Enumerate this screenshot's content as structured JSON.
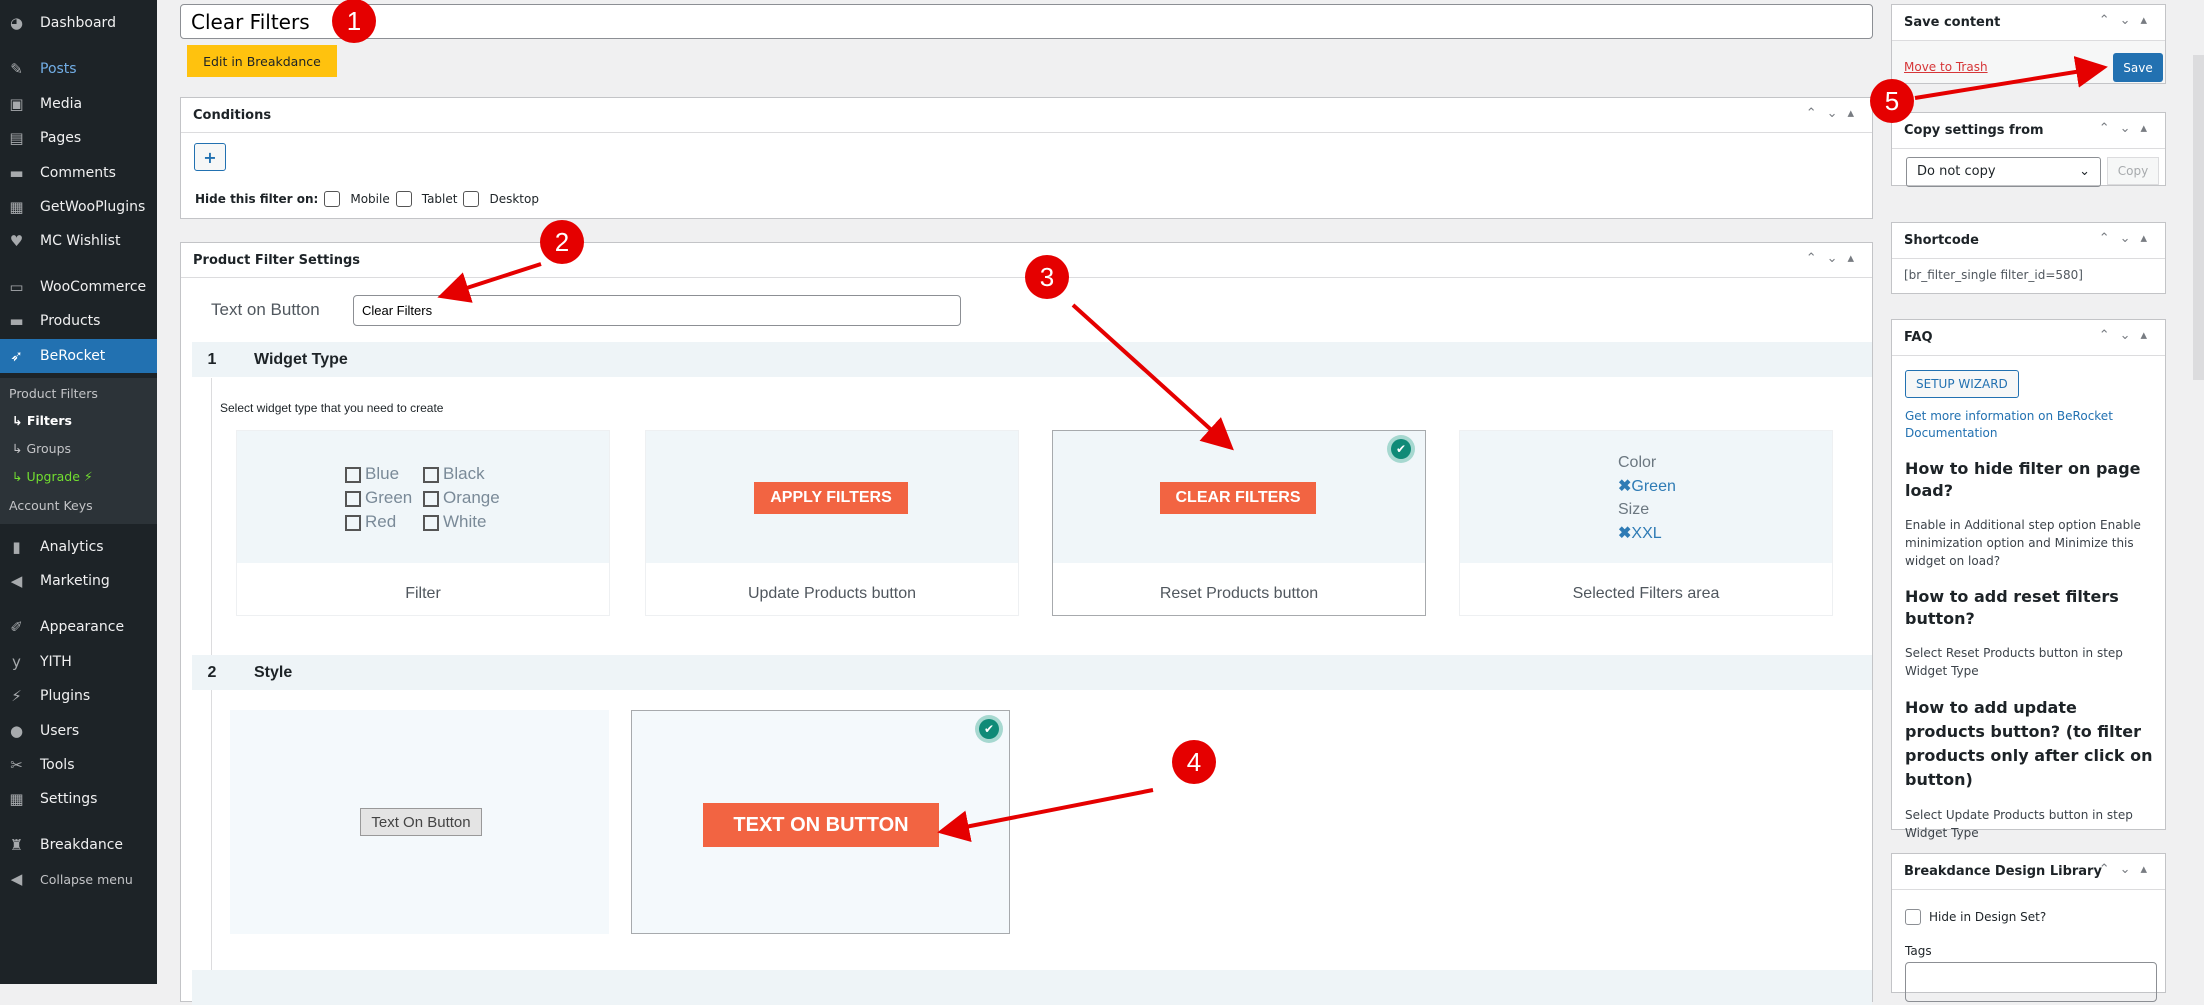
{
  "sidebar": {
    "items": [
      {
        "label": "Dashboard",
        "icon": "dashboard-icon",
        "glyph": "◕"
      },
      {
        "label": "Posts",
        "icon": "pin-icon",
        "glyph": "✎"
      },
      {
        "label": "Media",
        "icon": "media-icon",
        "glyph": "▣"
      },
      {
        "label": "Pages",
        "icon": "pages-icon",
        "glyph": "▤"
      },
      {
        "label": "Comments",
        "icon": "comment-icon",
        "glyph": "▬"
      },
      {
        "label": "GetWooPlugins",
        "icon": "plugin-box-icon",
        "glyph": "▦"
      },
      {
        "label": "MC Wishlist",
        "icon": "heart-icon",
        "glyph": "♥"
      },
      {
        "label": "WooCommerce",
        "icon": "woo-icon",
        "glyph": "▭"
      },
      {
        "label": "Products",
        "icon": "products-icon",
        "glyph": "▬"
      },
      {
        "label": "BeRocket",
        "icon": "rocket-icon",
        "glyph": "➶"
      },
      {
        "label": "Analytics",
        "icon": "analytics-icon",
        "glyph": "▮"
      },
      {
        "label": "Marketing",
        "icon": "megaphone-icon",
        "glyph": "◀"
      },
      {
        "label": "Appearance",
        "icon": "brush-icon",
        "glyph": "✐"
      },
      {
        "label": "YITH",
        "icon": "yith-icon",
        "glyph": "y"
      },
      {
        "label": "Plugins",
        "icon": "plug-icon",
        "glyph": "⚡"
      },
      {
        "label": "Users",
        "icon": "user-icon",
        "glyph": "●"
      },
      {
        "label": "Tools",
        "icon": "wrench-icon",
        "glyph": "✂"
      },
      {
        "label": "Settings",
        "icon": "settings-icon",
        "glyph": "▦"
      },
      {
        "label": "Breakdance",
        "icon": "breakdance-icon",
        "glyph": "♜"
      },
      {
        "label": "Collapse menu",
        "icon": "collapse-icon",
        "glyph": "◀"
      }
    ],
    "submenu": {
      "title": "Product Filters",
      "filters": "↳ Filters",
      "groups": "↳ Groups",
      "upgrade": "↳ Upgrade ⚡",
      "account": "Account Keys"
    }
  },
  "title_value": "Clear Filters",
  "edit_breakdance": "Edit in Breakdance",
  "conditions": {
    "title": "Conditions",
    "add": "+",
    "hide_label": "Hide this filter on:",
    "options": [
      "Mobile",
      "Tablet",
      "Desktop"
    ]
  },
  "settings": {
    "title": "Product Filter Settings",
    "text_label": "Text on Button",
    "text_value": "Clear Filters",
    "step1": {
      "num": "1",
      "title": "Widget Type",
      "hint": "Select widget type that you need to create",
      "cards": [
        {
          "label": "Filter"
        },
        {
          "label": "Update Products button",
          "button": "APPLY FILTERS"
        },
        {
          "label": "Reset Products button",
          "button": "CLEAR FILTERS",
          "selected": true
        },
        {
          "label": "Selected Filters area"
        }
      ],
      "filter_options": [
        "Blue",
        "Black",
        "Green",
        "Orange",
        "Red",
        "White"
      ],
      "selected_area": {
        "color": "Color",
        "green": "Green",
        "size": "Size",
        "xxl": "XXL"
      }
    },
    "step2": {
      "num": "2",
      "title": "Style",
      "plain_button": "Text On Button",
      "orange_button": "TEXT ON BUTTON",
      "selected": 2
    }
  },
  "right": {
    "save": {
      "title": "Save content",
      "trash": "Move to Trash",
      "save": "Save"
    },
    "copy": {
      "title": "Copy settings from",
      "select": "Do not copy",
      "button": "Copy"
    },
    "shortcode": {
      "title": "Shortcode",
      "value": "[br_filter_single filter_id=580]"
    },
    "faq": {
      "title": "FAQ",
      "wizard": "SETUP WIZARD",
      "link": "Get more information on BeRocket Documentation",
      "q1": "How to hide filter on page load?",
      "a1": "Enable in Additional step option Enable minimization option and Minimize this widget on load?",
      "q2": "How to add reset filters button?",
      "a2": "Select Reset Products button in step Widget Type",
      "q3": "How to add update products button? (to filter products only after click on button)",
      "a3": "Select Update Products button in step Widget Type"
    },
    "library": {
      "title": "Breakdance Design Library",
      "hide": "Hide in Design Set?",
      "tags": "Tags"
    }
  },
  "annotations": [
    "1",
    "2",
    "3",
    "4",
    "5"
  ],
  "colors": {
    "accent": "#2271b1",
    "orange": "#f26442",
    "annotation": "#e50000",
    "breakdance": "#ffc20e"
  }
}
